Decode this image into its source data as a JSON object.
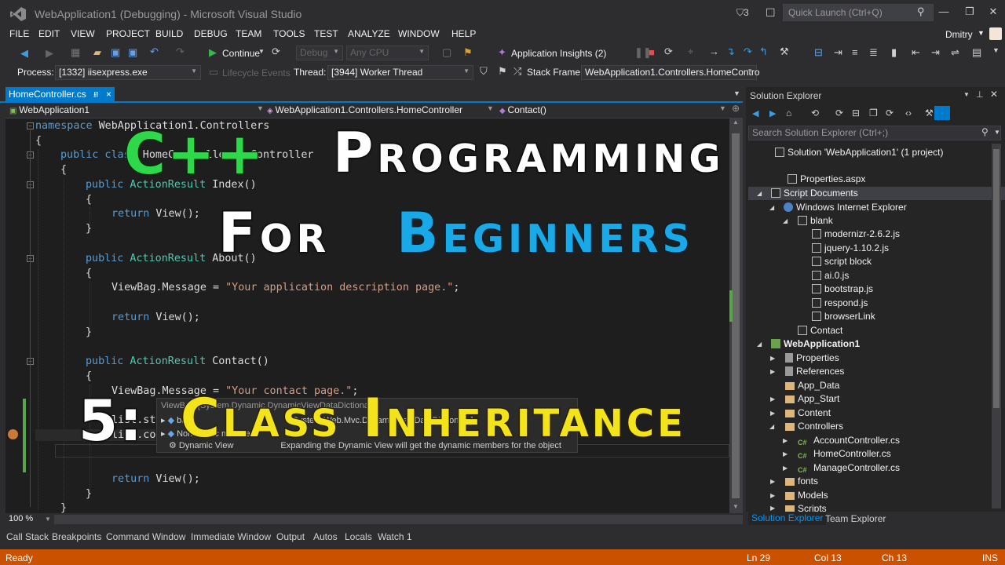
{
  "window": {
    "title": "WebApplication1 (Debugging) - Microsoft Visual Studio",
    "notifications_count": "3",
    "quick_launch_placeholder": "Quick Launch (Ctrl+Q)",
    "user": "Dmitry"
  },
  "menu": [
    "FILE",
    "EDIT",
    "VIEW",
    "PROJECT",
    "BUILD",
    "DEBUG",
    "TEAM",
    "TOOLS",
    "TEST",
    "ANALYZE",
    "WINDOW",
    "HELP"
  ],
  "toolbar": {
    "continue_label": "Continue",
    "config": "Debug",
    "platform": "Any CPU",
    "app_insights": "Application Insights (2)"
  },
  "debug_location": {
    "process_label": "Process:",
    "process_value": "[1332] iisexpress.exe",
    "lifecycle_label": "Lifecycle Events",
    "thread_label": "Thread:",
    "thread_value": "[3944] Worker Thread",
    "stackframe_label": "Stack Frame:",
    "stackframe_value": "WebApplication1.Controllers.HomeContro"
  },
  "editor": {
    "tab_label": "HomeController.cs",
    "tab_pin": "⭿",
    "tab_close": "×",
    "nav_project": "WebApplication1",
    "nav_class": "WebApplication1.Controllers.HomeController",
    "nav_member": "Contact()",
    "zoom": "100 %",
    "lines": {
      "l1_kw": "namespace",
      "l1_rest": " WebApplication1.Controllers",
      "l2": "{",
      "l3_kw": "public class",
      "l3_rest": " HomeController : Controller",
      "l4": "{",
      "l5_kw": "public",
      "l5_ty": " ActionResult",
      "l5_rest": " Index()",
      "l6": "{",
      "l7_kw": "return",
      "l7_rest": " View();",
      "l8": "}",
      "l9_kw": "public",
      "l9_ty": " ActionResult",
      "l9_rest": " About()",
      "l10": "{",
      "l11_a": "ViewBag.Message = ",
      "l11_str": "\"Your application description page.\"",
      "l11_b": ";",
      "l12_kw": "return",
      "l12_rest": " View();",
      "l13": "}",
      "l14_kw": "public",
      "l14_ty": " ActionResult",
      "l14_rest": " Contact()",
      "l15": "{",
      "l16_a": "ViewBag.Message = ",
      "l16_str": "\"Your contact page.\"",
      "l16_b": ";",
      "l17": "list.st",
      "l18": "list.co",
      "l19_kw": "return",
      "l19_rest": " View();",
      "l20": "}",
      "l21": "}"
    },
    "intellisense": {
      "header": "ViewBag   {System.Dynamic.DynamicViewDataDictionary}",
      "row1_name": "base",
      "row1_value": "{System.Web.Mvc.DynamicViewDataDictionary}",
      "row2_name": "Non-Public members",
      "row3_name": "Dynamic View",
      "row3_value": "Expanding the Dynamic View will get the dynamic members for the object"
    }
  },
  "solution_explorer": {
    "title": "Solution Explorer",
    "search_placeholder": "Search Solution Explorer (Ctrl+;)",
    "items": [
      {
        "label": "Solution 'WebApplication1' (1 project)",
        "bold": false
      },
      {
        "label": "Properties.aspx",
        "bold": false
      },
      {
        "label": "Script Documents",
        "bold": false
      },
      {
        "label": "Windows Internet Explorer",
        "bold": false
      },
      {
        "label": "blank",
        "bold": false
      },
      {
        "label": "modernizr-2.6.2.js",
        "bold": false
      },
      {
        "label": "jquery-1.10.2.js",
        "bold": false
      },
      {
        "label": "script block",
        "bold": false
      },
      {
        "label": "ai.0.js",
        "bold": false
      },
      {
        "label": "bootstrap.js",
        "bold": false
      },
      {
        "label": "respond.js",
        "bold": false
      },
      {
        "label": "browserLink",
        "bold": false
      },
      {
        "label": "Contact",
        "bold": false
      },
      {
        "label": "WebApplication1",
        "bold": true
      },
      {
        "label": "Properties",
        "bold": false
      },
      {
        "label": "References",
        "bold": false
      },
      {
        "label": "App_Data",
        "bold": false
      },
      {
        "label": "App_Start",
        "bold": false
      },
      {
        "label": "Content",
        "bold": false
      },
      {
        "label": "Controllers",
        "bold": false
      },
      {
        "label": "AccountController.cs",
        "bold": false
      },
      {
        "label": "HomeController.cs",
        "bold": false
      },
      {
        "label": "ManageController.cs",
        "bold": false
      },
      {
        "label": "fonts",
        "bold": false
      },
      {
        "label": "Models",
        "bold": false
      },
      {
        "label": "Scripts",
        "bold": false
      }
    ],
    "tab_solution": "Solution Explorer",
    "tab_team": "Team Explorer"
  },
  "bottom_tabs": [
    "Call Stack",
    "Breakpoints",
    "Command Window",
    "Immediate Window",
    "Output",
    "Autos",
    "Locals",
    "Watch 1"
  ],
  "status": {
    "ready": "Ready",
    "line": "Ln 29",
    "col": "Col 13",
    "ch": "Ch 13",
    "ins": "INS"
  },
  "overlay": {
    "line1_green": "C++",
    "line1_white": "Programming",
    "line2_white": "For",
    "line2_blue": "Beginners",
    "line3_white": "5:",
    "line3_yellow": "Class Inheritance"
  },
  "colors": {
    "accent": "#007acc",
    "status_debug": "#ca5100",
    "overlay_green": "#2fd84a",
    "overlay_blue": "#19a9e6",
    "overlay_yellow": "#f2e31b"
  }
}
